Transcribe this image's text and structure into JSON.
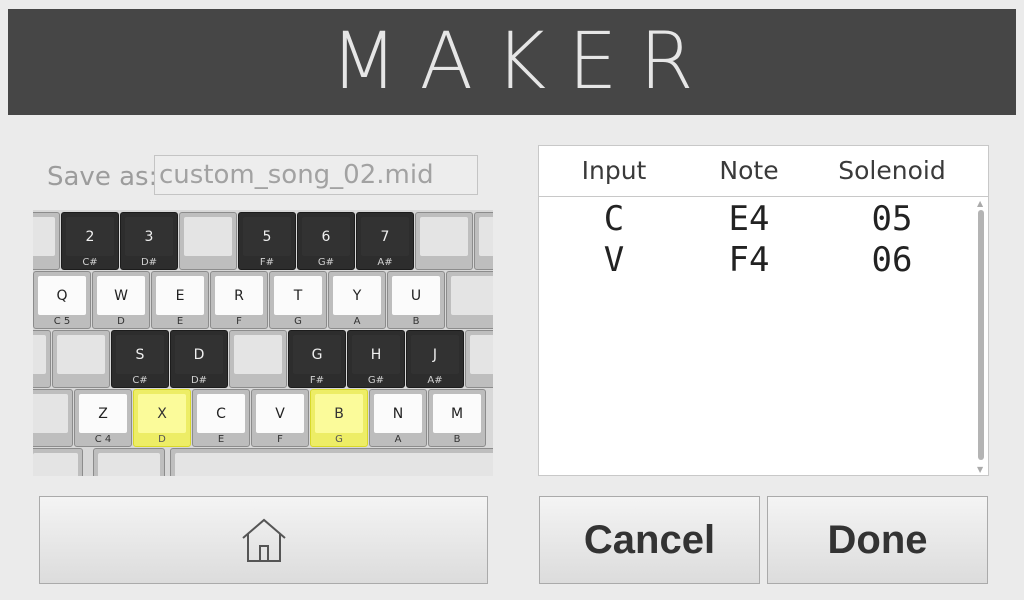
{
  "header": {
    "title": "MAKER"
  },
  "save": {
    "label": "Save as:",
    "value": "custom_song_02.mid"
  },
  "keyboard": {
    "rows": [
      [
        {
          "type": "blank",
          "label": "",
          "note": ""
        },
        {
          "type": "dark",
          "label": "2",
          "note": "C#"
        },
        {
          "type": "dark",
          "label": "3",
          "note": "D#"
        },
        {
          "type": "blank",
          "label": "",
          "note": ""
        },
        {
          "type": "dark",
          "label": "5",
          "note": "F#"
        },
        {
          "type": "dark",
          "label": "6",
          "note": "G#"
        },
        {
          "type": "dark",
          "label": "7",
          "note": "A#"
        },
        {
          "type": "blank",
          "label": "",
          "note": ""
        },
        {
          "type": "blank",
          "label": "",
          "note": ""
        }
      ],
      [
        {
          "type": "white",
          "label": "Q",
          "note": "C 5"
        },
        {
          "type": "white",
          "label": "W",
          "note": "D"
        },
        {
          "type": "white",
          "label": "E",
          "note": "E"
        },
        {
          "type": "white",
          "label": "R",
          "note": "F"
        },
        {
          "type": "white",
          "label": "T",
          "note": "G"
        },
        {
          "type": "white",
          "label": "Y",
          "note": "A"
        },
        {
          "type": "white",
          "label": "U",
          "note": "B"
        },
        {
          "type": "blank",
          "label": "",
          "note": ""
        }
      ],
      [
        {
          "type": "blank",
          "label": "",
          "note": ""
        },
        {
          "type": "blank",
          "label": "",
          "note": ""
        },
        {
          "type": "dark",
          "label": "S",
          "note": "C#"
        },
        {
          "type": "dark",
          "label": "D",
          "note": "D#"
        },
        {
          "type": "blank",
          "label": "",
          "note": ""
        },
        {
          "type": "dark",
          "label": "G",
          "note": "F#"
        },
        {
          "type": "dark",
          "label": "H",
          "note": "G#"
        },
        {
          "type": "dark",
          "label": "J",
          "note": "A#"
        },
        {
          "type": "blank",
          "label": "",
          "note": ""
        }
      ],
      [
        {
          "type": "blank",
          "label": "",
          "note": ""
        },
        {
          "type": "white",
          "label": "Z",
          "note": "C 4"
        },
        {
          "type": "highlight",
          "label": "X",
          "note": "D"
        },
        {
          "type": "white",
          "label": "C",
          "note": "E"
        },
        {
          "type": "white",
          "label": "V",
          "note": "F"
        },
        {
          "type": "highlight",
          "label": "B",
          "note": "G"
        },
        {
          "type": "white",
          "label": "N",
          "note": "A"
        },
        {
          "type": "white",
          "label": "M",
          "note": "B"
        }
      ]
    ]
  },
  "table": {
    "headers": [
      "Input",
      "Note",
      "Solenoid"
    ],
    "rows": [
      [
        "C",
        "E4",
        "05"
      ],
      [
        "V",
        "F4",
        "06"
      ]
    ]
  },
  "buttons": {
    "cancel": "Cancel",
    "done": "Done",
    "home_icon": "home-icon"
  },
  "colors": {
    "header_bg": "#464646",
    "highlight": "#fbfb9a",
    "dark_key": "#323232"
  }
}
